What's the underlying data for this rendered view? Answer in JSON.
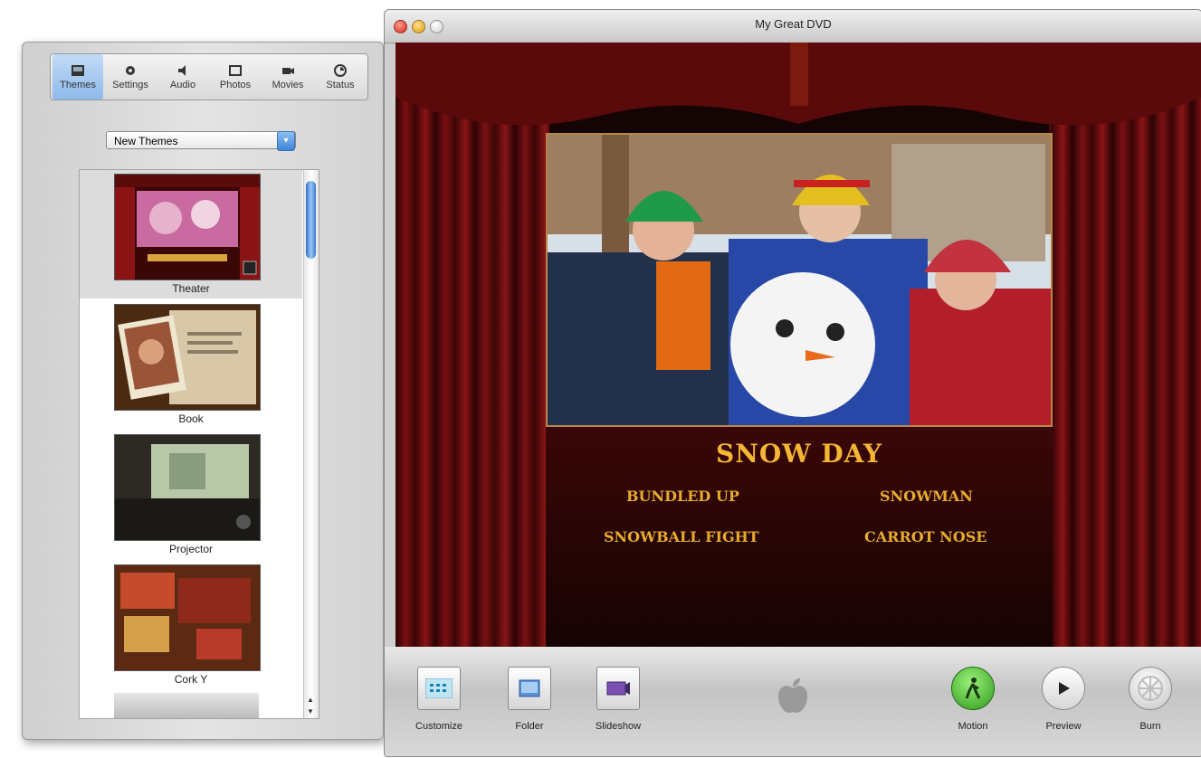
{
  "drawer": {
    "tabs": [
      {
        "label": "Themes",
        "icon": "themes-icon",
        "active": true
      },
      {
        "label": "Settings",
        "icon": "gear-icon",
        "active": false
      },
      {
        "label": "Audio",
        "icon": "speaker-icon",
        "active": false
      },
      {
        "label": "Photos",
        "icon": "photos-icon",
        "active": false
      },
      {
        "label": "Movies",
        "icon": "movies-icon",
        "active": false
      },
      {
        "label": "Status",
        "icon": "status-icon",
        "active": false
      }
    ],
    "theme_set": "New Themes",
    "themes": [
      {
        "label": "Theater",
        "selected": true
      },
      {
        "label": "Book",
        "selected": false
      },
      {
        "label": "Projector",
        "selected": false
      },
      {
        "label": "Cork Y",
        "selected": false
      }
    ]
  },
  "window": {
    "title": "My Great DVD"
  },
  "menu": {
    "title": "SNOW DAY",
    "buttons": [
      "BUNDLED UP",
      "SNOWMAN",
      "SNOWBALL FIGHT",
      "CARROT NOSE"
    ]
  },
  "toolbar": {
    "left": [
      {
        "label": "Customize",
        "icon": "customize-icon"
      },
      {
        "label": "Folder",
        "icon": "folder-icon"
      },
      {
        "label": "Slideshow",
        "icon": "slideshow-icon"
      }
    ],
    "center_icon": "apple-logo",
    "right": [
      {
        "label": "Motion",
        "icon": "motion-icon"
      },
      {
        "label": "Preview",
        "icon": "play-icon"
      },
      {
        "label": "Burn",
        "icon": "burn-icon"
      }
    ]
  },
  "colors": {
    "menu_text": "#e6ac2e",
    "curtain": "#6e0f10",
    "selection": "#8db9ea"
  }
}
